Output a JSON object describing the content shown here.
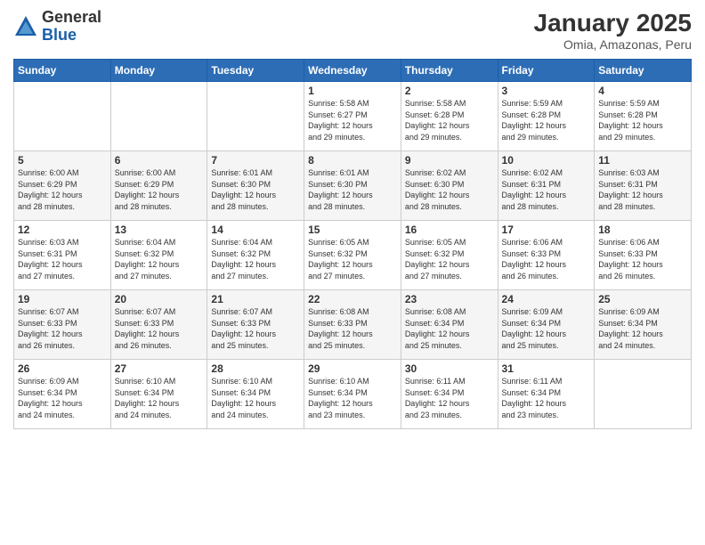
{
  "header": {
    "logo_general": "General",
    "logo_blue": "Blue",
    "month_title": "January 2025",
    "location": "Omia, Amazonas, Peru"
  },
  "days_of_week": [
    "Sunday",
    "Monday",
    "Tuesday",
    "Wednesday",
    "Thursday",
    "Friday",
    "Saturday"
  ],
  "weeks": [
    [
      {
        "day": "",
        "info": ""
      },
      {
        "day": "",
        "info": ""
      },
      {
        "day": "",
        "info": ""
      },
      {
        "day": "1",
        "info": "Sunrise: 5:58 AM\nSunset: 6:27 PM\nDaylight: 12 hours\nand 29 minutes."
      },
      {
        "day": "2",
        "info": "Sunrise: 5:58 AM\nSunset: 6:28 PM\nDaylight: 12 hours\nand 29 minutes."
      },
      {
        "day": "3",
        "info": "Sunrise: 5:59 AM\nSunset: 6:28 PM\nDaylight: 12 hours\nand 29 minutes."
      },
      {
        "day": "4",
        "info": "Sunrise: 5:59 AM\nSunset: 6:28 PM\nDaylight: 12 hours\nand 29 minutes."
      }
    ],
    [
      {
        "day": "5",
        "info": "Sunrise: 6:00 AM\nSunset: 6:29 PM\nDaylight: 12 hours\nand 28 minutes."
      },
      {
        "day": "6",
        "info": "Sunrise: 6:00 AM\nSunset: 6:29 PM\nDaylight: 12 hours\nand 28 minutes."
      },
      {
        "day": "7",
        "info": "Sunrise: 6:01 AM\nSunset: 6:30 PM\nDaylight: 12 hours\nand 28 minutes."
      },
      {
        "day": "8",
        "info": "Sunrise: 6:01 AM\nSunset: 6:30 PM\nDaylight: 12 hours\nand 28 minutes."
      },
      {
        "day": "9",
        "info": "Sunrise: 6:02 AM\nSunset: 6:30 PM\nDaylight: 12 hours\nand 28 minutes."
      },
      {
        "day": "10",
        "info": "Sunrise: 6:02 AM\nSunset: 6:31 PM\nDaylight: 12 hours\nand 28 minutes."
      },
      {
        "day": "11",
        "info": "Sunrise: 6:03 AM\nSunset: 6:31 PM\nDaylight: 12 hours\nand 28 minutes."
      }
    ],
    [
      {
        "day": "12",
        "info": "Sunrise: 6:03 AM\nSunset: 6:31 PM\nDaylight: 12 hours\nand 27 minutes."
      },
      {
        "day": "13",
        "info": "Sunrise: 6:04 AM\nSunset: 6:32 PM\nDaylight: 12 hours\nand 27 minutes."
      },
      {
        "day": "14",
        "info": "Sunrise: 6:04 AM\nSunset: 6:32 PM\nDaylight: 12 hours\nand 27 minutes."
      },
      {
        "day": "15",
        "info": "Sunrise: 6:05 AM\nSunset: 6:32 PM\nDaylight: 12 hours\nand 27 minutes."
      },
      {
        "day": "16",
        "info": "Sunrise: 6:05 AM\nSunset: 6:32 PM\nDaylight: 12 hours\nand 27 minutes."
      },
      {
        "day": "17",
        "info": "Sunrise: 6:06 AM\nSunset: 6:33 PM\nDaylight: 12 hours\nand 26 minutes."
      },
      {
        "day": "18",
        "info": "Sunrise: 6:06 AM\nSunset: 6:33 PM\nDaylight: 12 hours\nand 26 minutes."
      }
    ],
    [
      {
        "day": "19",
        "info": "Sunrise: 6:07 AM\nSunset: 6:33 PM\nDaylight: 12 hours\nand 26 minutes."
      },
      {
        "day": "20",
        "info": "Sunrise: 6:07 AM\nSunset: 6:33 PM\nDaylight: 12 hours\nand 26 minutes."
      },
      {
        "day": "21",
        "info": "Sunrise: 6:07 AM\nSunset: 6:33 PM\nDaylight: 12 hours\nand 25 minutes."
      },
      {
        "day": "22",
        "info": "Sunrise: 6:08 AM\nSunset: 6:33 PM\nDaylight: 12 hours\nand 25 minutes."
      },
      {
        "day": "23",
        "info": "Sunrise: 6:08 AM\nSunset: 6:34 PM\nDaylight: 12 hours\nand 25 minutes."
      },
      {
        "day": "24",
        "info": "Sunrise: 6:09 AM\nSunset: 6:34 PM\nDaylight: 12 hours\nand 25 minutes."
      },
      {
        "day": "25",
        "info": "Sunrise: 6:09 AM\nSunset: 6:34 PM\nDaylight: 12 hours\nand 24 minutes."
      }
    ],
    [
      {
        "day": "26",
        "info": "Sunrise: 6:09 AM\nSunset: 6:34 PM\nDaylight: 12 hours\nand 24 minutes."
      },
      {
        "day": "27",
        "info": "Sunrise: 6:10 AM\nSunset: 6:34 PM\nDaylight: 12 hours\nand 24 minutes."
      },
      {
        "day": "28",
        "info": "Sunrise: 6:10 AM\nSunset: 6:34 PM\nDaylight: 12 hours\nand 24 minutes."
      },
      {
        "day": "29",
        "info": "Sunrise: 6:10 AM\nSunset: 6:34 PM\nDaylight: 12 hours\nand 23 minutes."
      },
      {
        "day": "30",
        "info": "Sunrise: 6:11 AM\nSunset: 6:34 PM\nDaylight: 12 hours\nand 23 minutes."
      },
      {
        "day": "31",
        "info": "Sunrise: 6:11 AM\nSunset: 6:34 PM\nDaylight: 12 hours\nand 23 minutes."
      },
      {
        "day": "",
        "info": ""
      }
    ]
  ]
}
